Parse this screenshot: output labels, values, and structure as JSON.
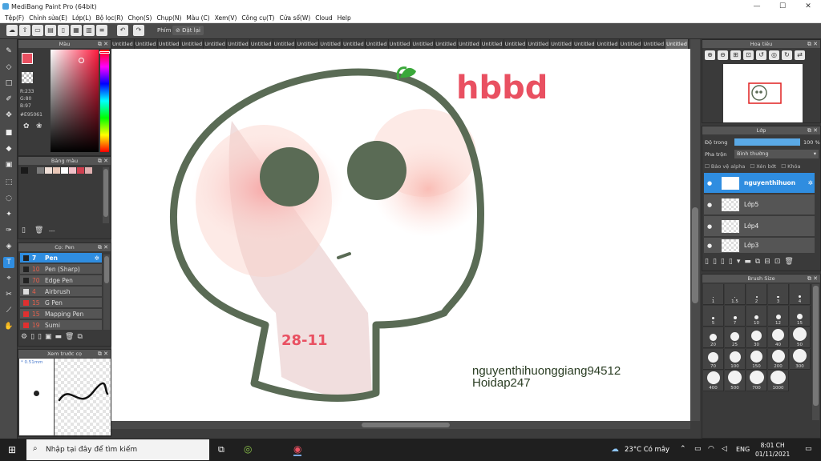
{
  "window": {
    "title": "MediBang Paint Pro (64bit)",
    "minimize": "—",
    "maximize": "☐",
    "close": "✕"
  },
  "menu": [
    "Tệp(F)",
    "Chỉnh sửa(E)",
    "Lớp(L)",
    "Bộ lọc(R)",
    "Chọn(S)",
    "Chụp(N)",
    "Màu (C)",
    "Xem(V)",
    "Công cụ(T)",
    "Cửa sổ(W)",
    "Cloud",
    "Help"
  ],
  "toolbar": {
    "phim_label": "Phím",
    "reset_label": "Đặt lại"
  },
  "color_panel": {
    "title": "Màu",
    "r": "R:233",
    "g": "G:80",
    "b": "B:97",
    "hex": "#E95061",
    "fg_color": "#e95061",
    "bg_color": "#ffffff"
  },
  "palette_panel": {
    "title": "Bảng màu",
    "swatches": [
      "#1a1a1a",
      "#3a3a3a",
      "#7a7a7a",
      "#f0e0d8",
      "#e9c8b8",
      "#ffffff",
      "#f0c0c8",
      "#d04050",
      "#e0b0b0"
    ],
    "dash": "---"
  },
  "brush_panel": {
    "title": "Cọ: Pen",
    "items": [
      {
        "num": "7",
        "name": "Pen",
        "color": "#222222"
      },
      {
        "num": "10",
        "name": "Pen (Sharp)",
        "color": "#222222"
      },
      {
        "num": "70",
        "name": "Edge Pen",
        "color": "#222222"
      },
      {
        "num": "4",
        "name": "Airbrush",
        "color": "#dddddd"
      },
      {
        "num": "15",
        "name": "G Pen",
        "color": "#e03030"
      },
      {
        "num": "15",
        "name": "Mapping Pen",
        "color": "#e03030"
      },
      {
        "num": "19",
        "name": "Sumi",
        "color": "#e03030"
      }
    ]
  },
  "preview_panel": {
    "title": "Xem trước cọ",
    "size": "* 0.51mm"
  },
  "tabs": [
    "Untitled",
    "Untitled",
    "Untitled",
    "Untitled",
    "Untitled",
    "Untitled",
    "Untitled",
    "Untitled",
    "Untitled",
    "Untitled",
    "Untitled",
    "Untitled",
    "Untitled",
    "Untitled",
    "Untitled",
    "Untitled",
    "Untitled",
    "Untitled",
    "Untitled",
    "Untitled",
    "Untitled",
    "Untitled",
    "Untitled",
    "Untitled",
    "Untitled"
  ],
  "artwork": {
    "title_text": "hbbd",
    "date_text": "28-11",
    "signature_line1": "nguyenthihuonggiang94512",
    "signature_line2": "Hoidap247",
    "outline_color": "#5a6b55",
    "accent_color": "#e95061"
  },
  "navigator_panel": {
    "title": "Hoa tiêu"
  },
  "layer_panel": {
    "title": "Lớp",
    "opacity_label": "Độ trong",
    "opacity_value": "100 %",
    "opacity_percent": 100,
    "blend_label": "Pha trộn",
    "blend_value": "Bình thường",
    "protect_alpha": "Bảo vệ alpha",
    "clipping": "Xén bớt",
    "lock": "Khóa",
    "layers": [
      {
        "name": "nguyenthihuon",
        "selected": true
      },
      {
        "name": "Lớp5",
        "selected": false
      },
      {
        "name": "Lớp4",
        "selected": false
      },
      {
        "name": "Lớp3",
        "selected": false
      }
    ]
  },
  "brushsize_panel": {
    "title": "Brush Size",
    "sizes": [
      "1",
      "1.5",
      "2",
      "3",
      "4",
      "5",
      "7",
      "10",
      "12",
      "15",
      "20",
      "25",
      "30",
      "40",
      "50",
      "70",
      "100",
      "150",
      "200",
      "300",
      "400",
      "500",
      "700",
      "1000"
    ]
  },
  "taskbar": {
    "search_placeholder": "Nhập tại đây để tìm kiếm",
    "weather": "23°C  Có mây",
    "lang": "ENG",
    "time": "8:01 CH",
    "date": "01/11/2021"
  }
}
